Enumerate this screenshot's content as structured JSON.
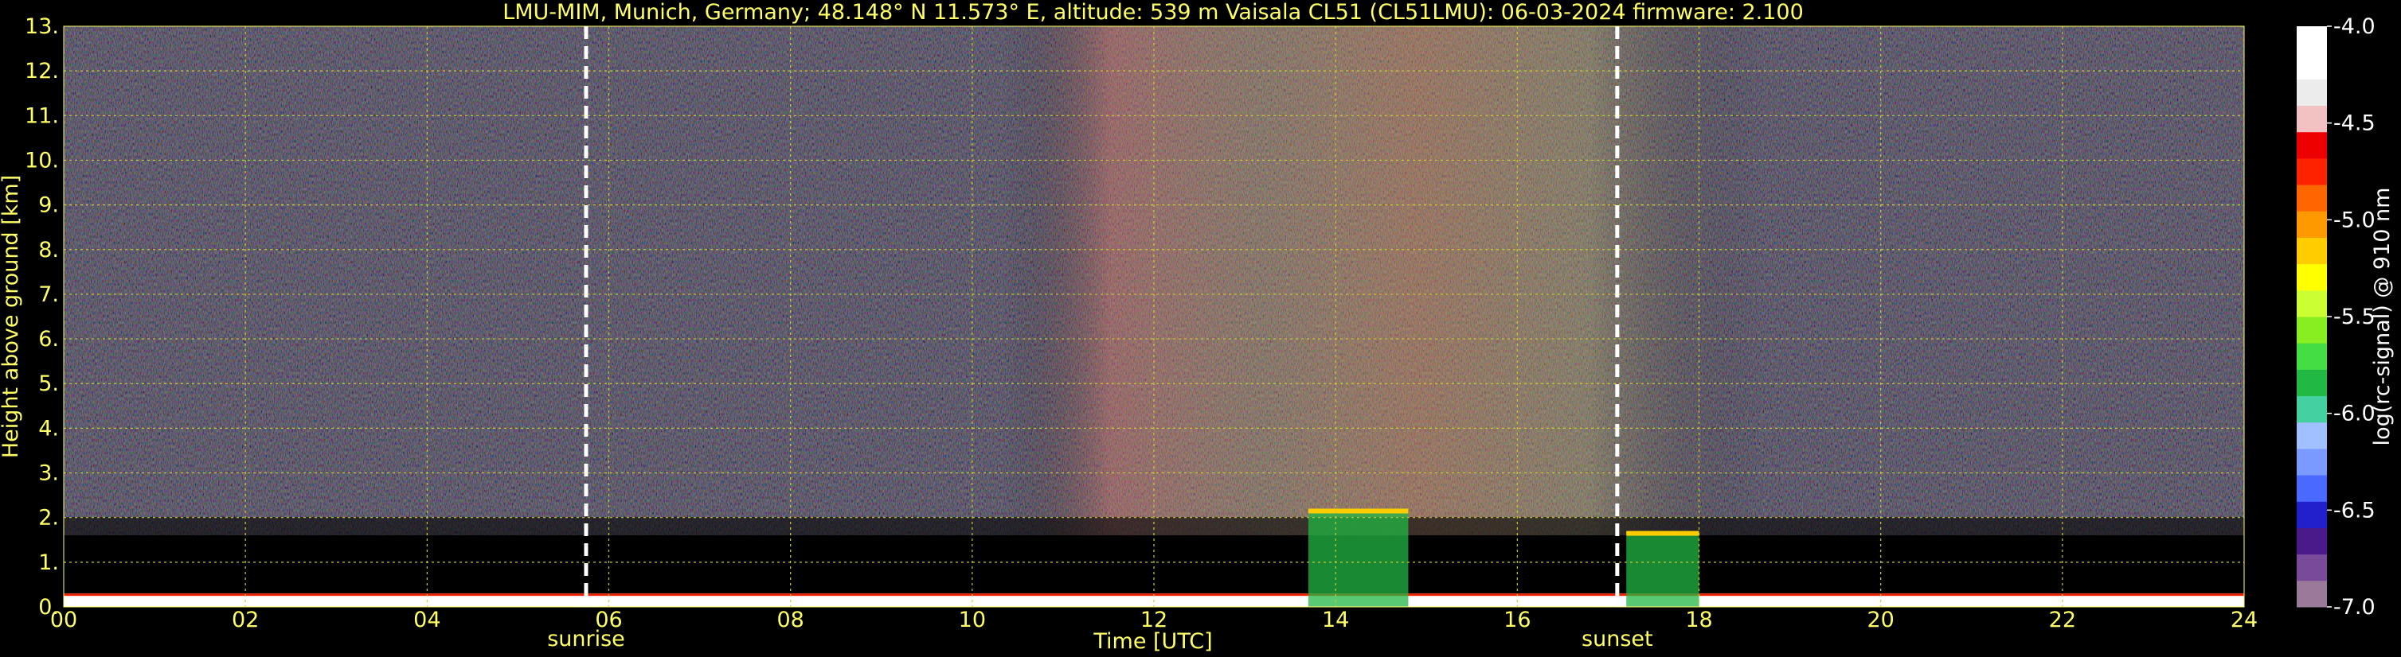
{
  "chart_data": {
    "type": "heatmap",
    "title": "LMU-MIM, Munich, Germany; 48.148° N 11.573° E, altitude: 539 m    Vaisala CL51 (CL51LMU): 06-03-2024    firmware: 2.100",
    "xlabel": "Time [UTC]",
    "ylabel": "Height above ground [km]",
    "xlim": [
      0,
      24
    ],
    "ylim": [
      0,
      13
    ],
    "x_ticks": [
      "00",
      "02",
      "04",
      "06",
      "08",
      "10",
      "12",
      "14",
      "16",
      "18",
      "20",
      "22",
      "24"
    ],
    "y_ticks": [
      "0.",
      "1.",
      "2.",
      "3.",
      "4.",
      "5.",
      "6.",
      "7.",
      "8.",
      "9.",
      "10.",
      "11.",
      "12.",
      "13."
    ],
    "grid": true,
    "annotations": [
      {
        "text": "sunrise",
        "x": 5.75
      },
      {
        "text": "sunset",
        "x": 17.1
      }
    ],
    "colorbar": {
      "label": "log(rc-signal) @ 910 nm",
      "range": [
        -7.0,
        -4.0
      ],
      "ticks": [
        "-4.0",
        "-4.5",
        "-5.0",
        "-5.5",
        "-6.0",
        "-6.5",
        "-7.0"
      ],
      "colors": [
        "#9a7a9a",
        "#7a4a9a",
        "#4a1a8a",
        "#2020cc",
        "#4a6aff",
        "#7a9aff",
        "#a0c0ff",
        "#44d0a0",
        "#22b844",
        "#44dd44",
        "#88ee22",
        "#ccff33",
        "#ffff00",
        "#ffcc00",
        "#ff9900",
        "#ff6600",
        "#ff2200",
        "#ee0000",
        "#f2c2c2",
        "#ececec",
        "#ffffff",
        "#ffffff"
      ]
    },
    "features": [
      {
        "name": "boundary layer",
        "x0": 0,
        "x1": 24,
        "top_km": 0.3
      },
      {
        "name": "low cloud",
        "x0": 13.7,
        "x1": 14.8,
        "top_km": 2.2
      },
      {
        "name": "low cloud",
        "x0": 17.2,
        "x1": 18.0,
        "top_km": 1.7
      }
    ]
  }
}
